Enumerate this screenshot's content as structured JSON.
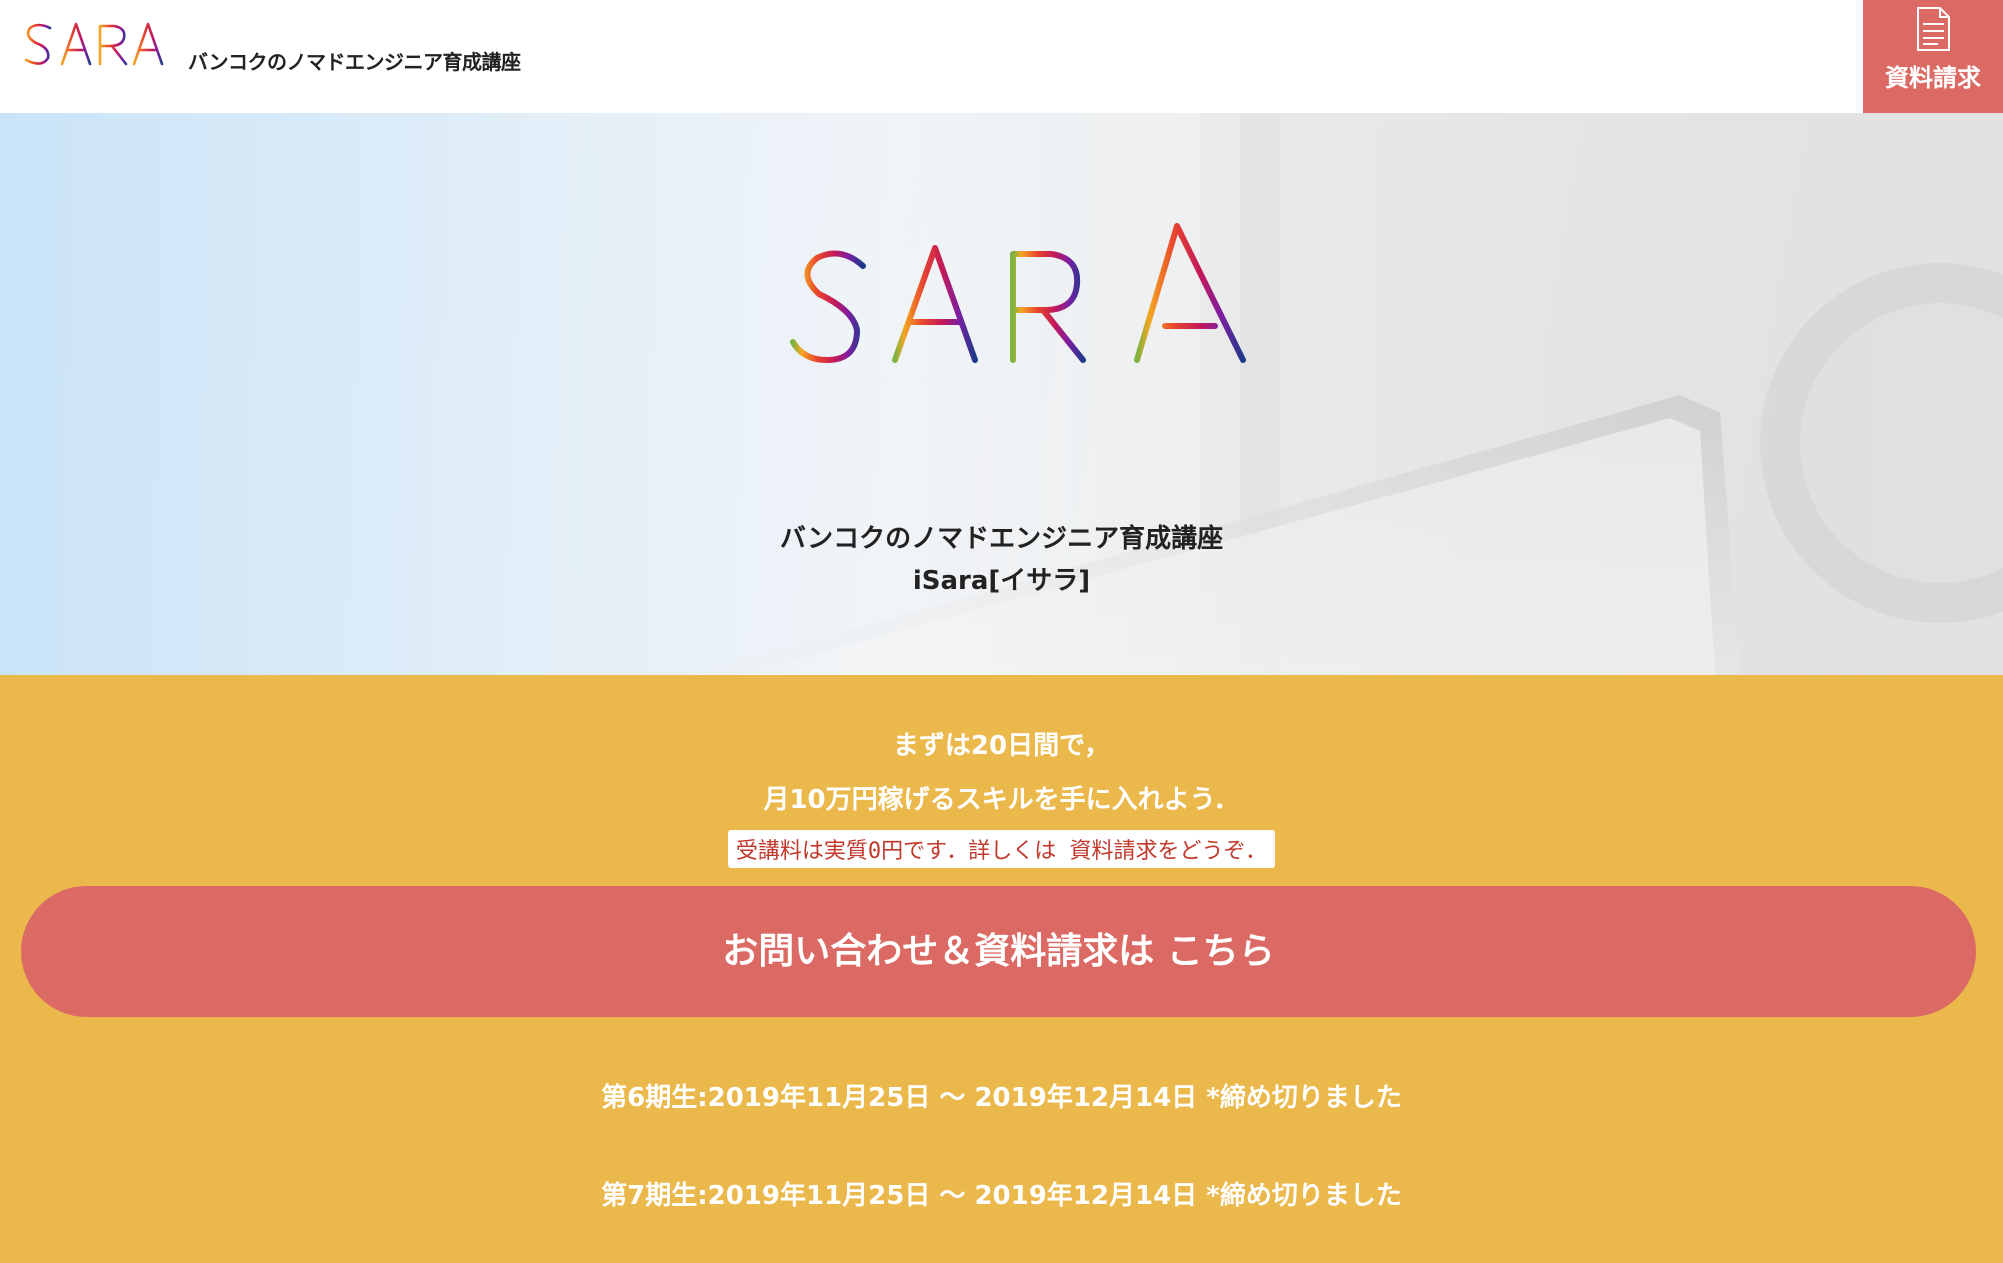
{
  "header": {
    "logo_text": "iSARA",
    "tagline": "バンコクのノマドエンジニア育成講座",
    "request_button_label": "資料請求"
  },
  "hero": {
    "logo_text": "iSARA",
    "subtitle": "バンコクのノマドエンジニア育成講座",
    "name": "iSara[イサラ]"
  },
  "cta": {
    "catch_line_1": "まずは20日間で，",
    "catch_line_2": "月10万円稼げるスキルを手に入れよう．",
    "fee_note": "受講料は実質0円です．詳しくは 資料請求をどうぞ．",
    "contact_button_label": "お問い合わせ＆資料請求は こちら",
    "terms": [
      "第6期生:2019年11月25日 〜 2019年12月14日 *締め切りました",
      "第7期生:2019年11月25日 〜 2019年12月14日 *締め切りました"
    ]
  },
  "colors": {
    "accent_red": "#dc6a64",
    "cta_yellow": "#ebb84c",
    "logo_gradient": [
      "#f5a623",
      "#e8452c",
      "#c2185b",
      "#7b1fa2",
      "#1e3a8a"
    ]
  },
  "icons": {
    "request": "document-icon"
  }
}
